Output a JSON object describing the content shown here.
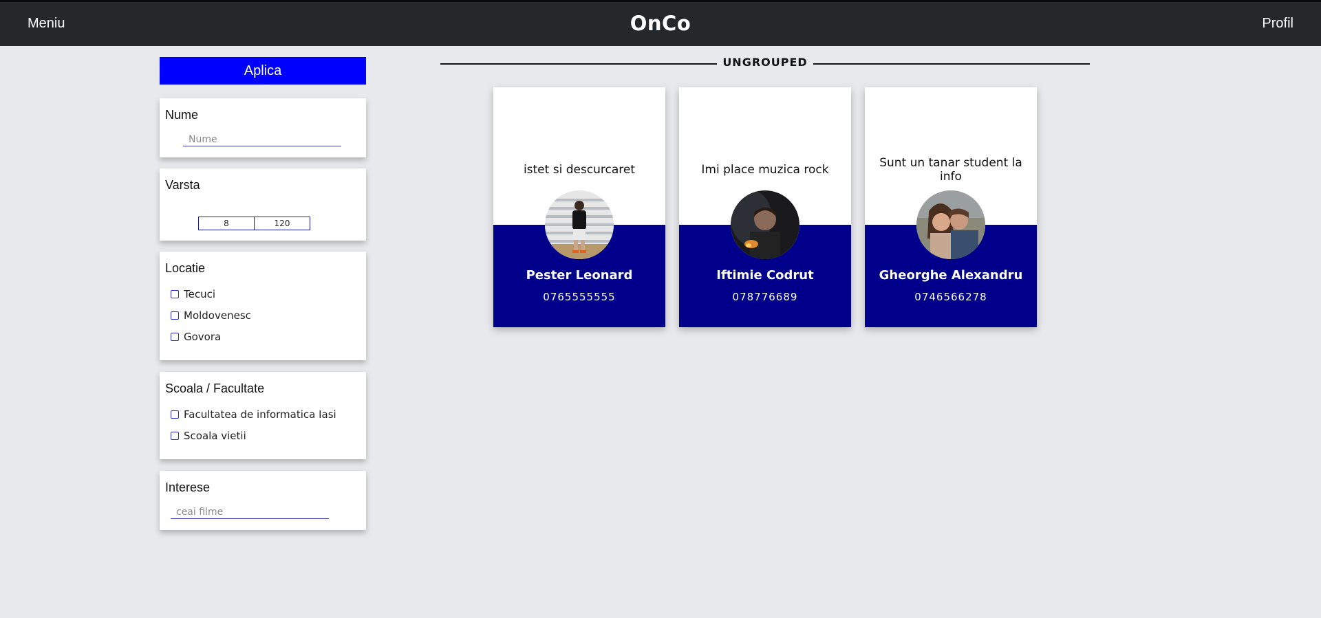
{
  "header": {
    "menu_label": "Meniu",
    "logo": "OnCo",
    "profile_label": "Profil"
  },
  "filters": {
    "apply_label": "Aplica",
    "name": {
      "title": "Nume",
      "placeholder": "Nume"
    },
    "age": {
      "title": "Varsta",
      "min": "8",
      "max": "120"
    },
    "location": {
      "title": "Locatie",
      "options": [
        "Tecuci",
        "Moldovenesc",
        "Govora"
      ]
    },
    "school": {
      "title": "Scoala / Facultate",
      "options": [
        "Facultatea de informatica Iasi",
        "Scoala vietii"
      ]
    },
    "interests": {
      "title": "Interese",
      "placeholder": "ceai filme"
    }
  },
  "section": {
    "title": "UNGROUPED"
  },
  "cards": [
    {
      "description": "istet si descurcaret",
      "name": "Pester Leonard",
      "phone": "0765555555"
    },
    {
      "description": "Imi place muzica rock",
      "name": "Iftimie Codrut",
      "phone": "078776689"
    },
    {
      "description": "Sunt un tanar student la info",
      "name": "Gheorghe Alexandru",
      "phone": "0746566278"
    }
  ],
  "colors": {
    "apply": "#0000ff",
    "card_bottom": "#00008b",
    "topbar": "#25282b"
  }
}
